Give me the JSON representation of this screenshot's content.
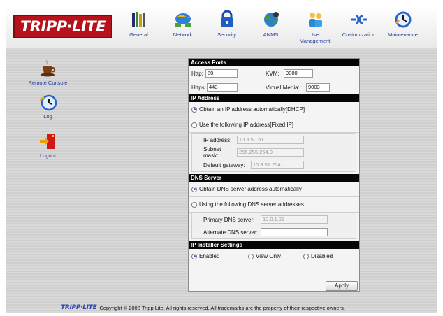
{
  "brand": {
    "logo_text": "TRIPP·LITE",
    "footer_logo_text": "TRIPP·LITE"
  },
  "nav": {
    "items": [
      {
        "label": "General",
        "icon": "books-icon"
      },
      {
        "label": "Network",
        "icon": "network-globe-icon"
      },
      {
        "label": "Security",
        "icon": "lock-icon"
      },
      {
        "label": "ANMS",
        "icon": "anms-globe-icon"
      },
      {
        "label": "User\nManagement",
        "icon": "users-icon"
      },
      {
        "label": "Customization",
        "icon": "plug-icon"
      },
      {
        "label": "Maintenance",
        "icon": "clock-icon"
      }
    ]
  },
  "sidebar": {
    "items": [
      {
        "label": "Remote Console",
        "icon": "coffee-cup-icon"
      },
      {
        "label": "Log",
        "icon": "log-clock-icon"
      },
      {
        "label": "Logout",
        "icon": "exit-door-icon"
      }
    ]
  },
  "access_ports": {
    "title": "Access Ports",
    "http_label": "Http:",
    "http_value": "80",
    "kvm_label": "KVM:",
    "kvm_value": "9000",
    "https_label": "Https:",
    "https_value": "443",
    "vmedia_label": "Virtual Media:",
    "vmedia_value": "9003"
  },
  "ip_address": {
    "title": "IP Address",
    "dhcp_label": "Obtain an IP address automatically[DHCP]",
    "fixed_label": "Use the following IP address[Fixed IP]",
    "ip_label": "IP address:",
    "ip_value": "10.3.50.51",
    "subnet_label": "Subnet mask:",
    "subnet_value": "255.255.254.0",
    "gateway_label": "Default gateway:",
    "gateway_value": "10.3.51.254"
  },
  "dns": {
    "title": "DNS Server",
    "auto_label": "Obtain DNS server address automatically",
    "manual_label": "Using the following DNS server addresses",
    "primary_label": "Primary DNS server:",
    "primary_value": "10.0.1.23",
    "alternate_label": "Alternate DNS server:",
    "alternate_value": ""
  },
  "installer": {
    "title": "IP Installer Settings",
    "enabled_label": "Enabled",
    "viewonly_label": "View Only",
    "disabled_label": "Disabled"
  },
  "apply_label": "Apply",
  "footer": {
    "copyright": "Copyright © 2008 Tripp Lite. All rights reserved. All trademarks are the property of their respective owners."
  },
  "colors": {
    "brand_red": "#b5121b",
    "section_header": "#050505",
    "link_blue": "#1f3c99"
  }
}
